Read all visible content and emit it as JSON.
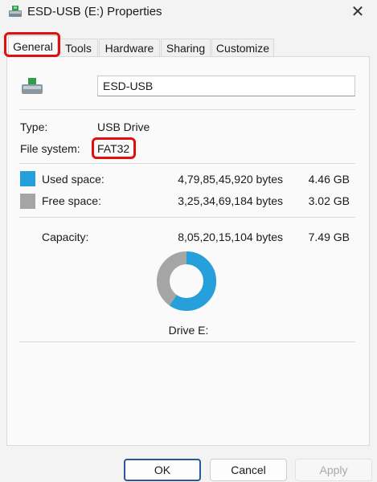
{
  "window": {
    "title": "ESD-USB (E:) Properties",
    "close_glyph": "✕",
    "icon": "usb-drive-icon"
  },
  "tabs": [
    {
      "label": "General",
      "active": true
    },
    {
      "label": "Tools"
    },
    {
      "label": "Hardware"
    },
    {
      "label": "Sharing"
    },
    {
      "label": "Customize"
    }
  ],
  "general": {
    "volume_name": "ESD-USB",
    "type_label": "Type:",
    "type_value": "USB Drive",
    "fs_label": "File system:",
    "fs_value": "FAT32",
    "used": {
      "label": "Used space:",
      "bytes": "4,79,85,45,920 bytes",
      "size": "4.46 GB",
      "color": "#26a0da"
    },
    "free": {
      "label": "Free space:",
      "bytes": "3,25,34,69,184 bytes",
      "size": "3.02 GB",
      "color": "#a5a5a5"
    },
    "capacity": {
      "label": "Capacity:",
      "bytes": "8,05,20,15,104 bytes",
      "size": "7.49 GB"
    },
    "used_fraction": 0.5955,
    "drive_label": "Drive E:"
  },
  "buttons": {
    "ok": "OK",
    "cancel": "Cancel",
    "apply": "Apply"
  },
  "colors": {
    "highlight": "#e01010",
    "ok_border": "#2b5797"
  }
}
